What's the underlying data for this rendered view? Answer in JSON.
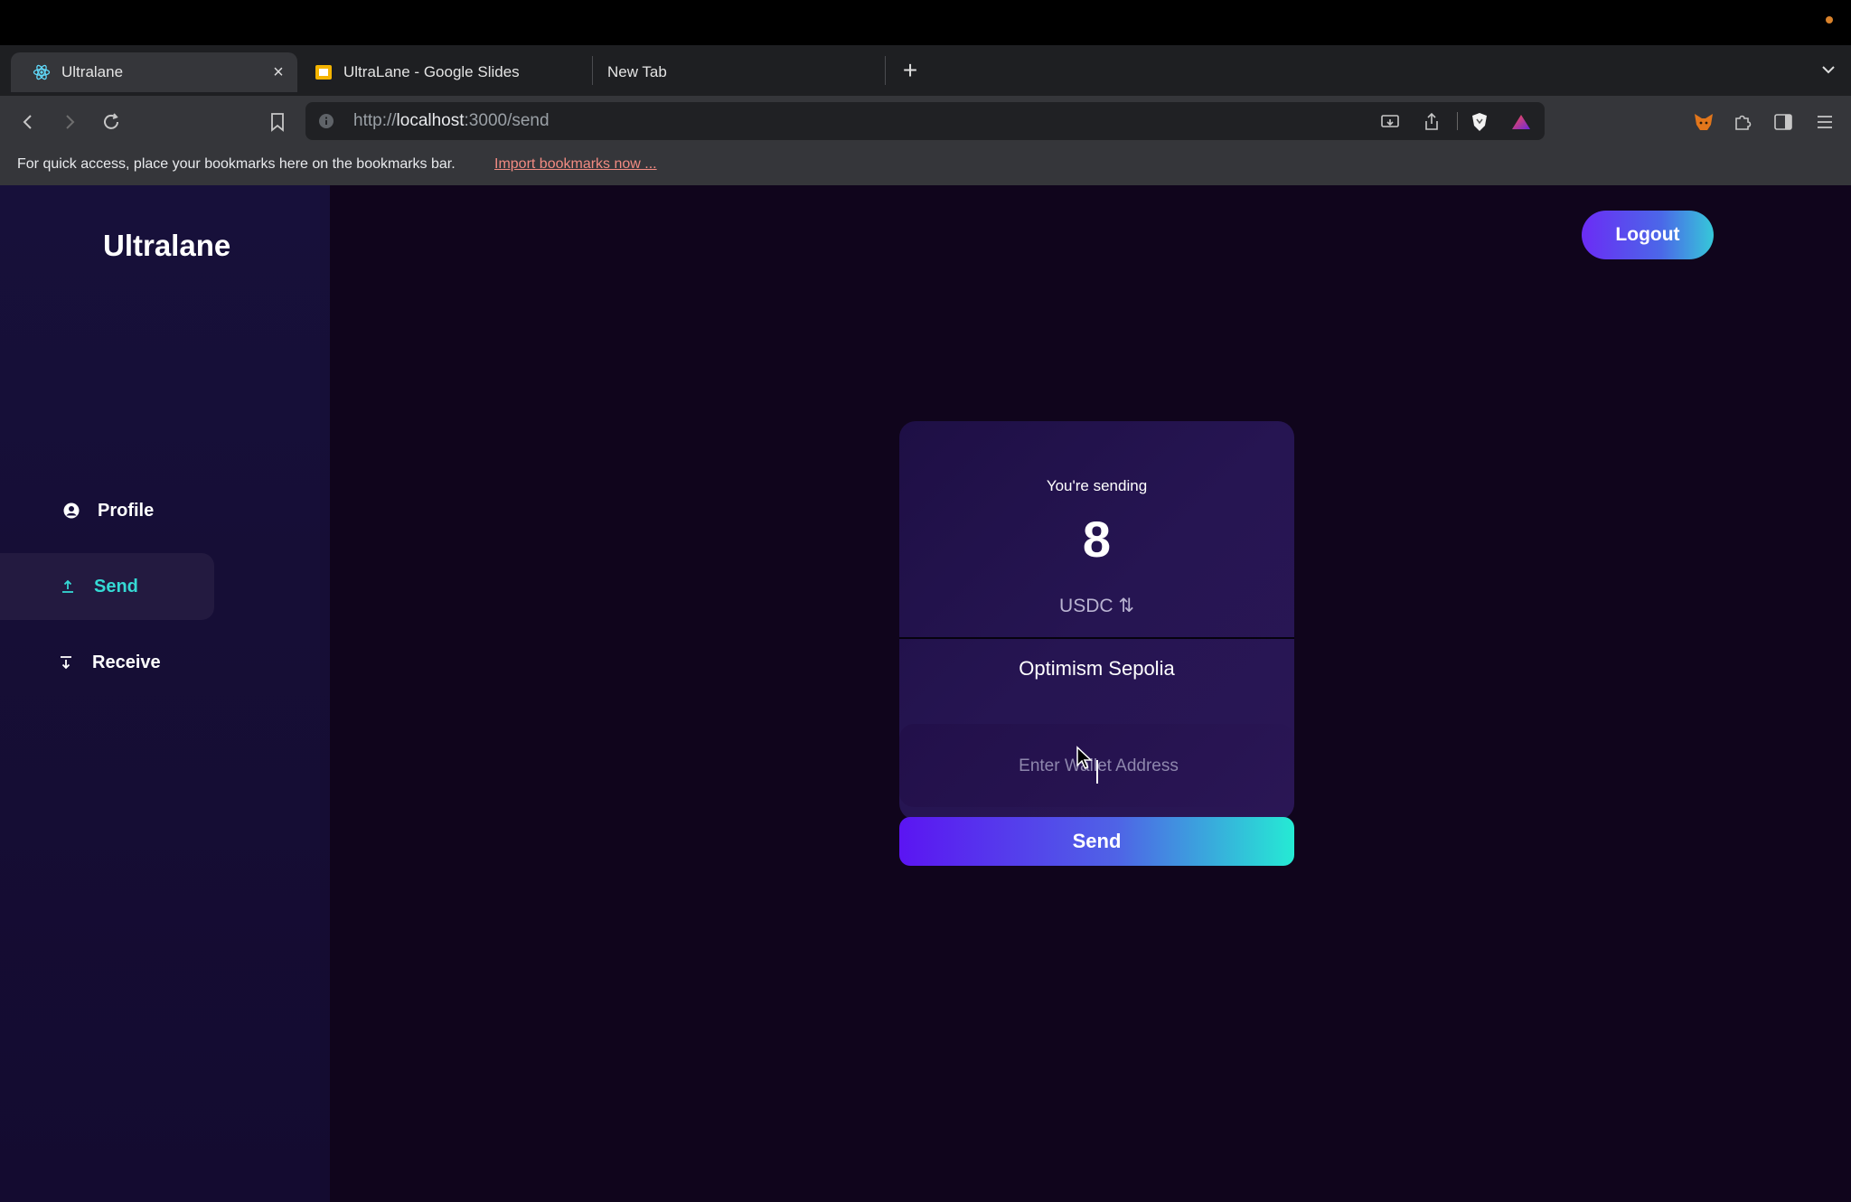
{
  "browser": {
    "tabs": [
      {
        "title": "Ultralane",
        "favicon": "react-icon",
        "active": true
      },
      {
        "title": "UltraLane - Google Slides",
        "favicon": "google-slides-icon",
        "active": false
      },
      {
        "title": "New Tab",
        "favicon": "",
        "active": false
      }
    ],
    "url_scheme": "http://",
    "url_host": "localhost",
    "url_path": ":3000/send",
    "bookmarks_bar": {
      "message": "For quick access, place your bookmarks here on the bookmarks bar.",
      "link": "Import bookmarks now ..."
    }
  },
  "app": {
    "brand": "Ultralane",
    "logout_label": "Logout",
    "sidebar": {
      "items": [
        {
          "label": "Profile",
          "icon": "user-circle-icon",
          "active": false
        },
        {
          "label": "Send",
          "icon": "upload-icon",
          "active": true
        },
        {
          "label": "Receive",
          "icon": "download-icon",
          "active": false
        }
      ]
    },
    "send_card": {
      "label": "You're sending",
      "amount": "8",
      "token": "USDC ⇅",
      "network": "Optimism Sepolia"
    },
    "address_input": {
      "placeholder": "Enter Wallet Address",
      "value": ""
    },
    "send_button_label": "Send"
  },
  "colors": {
    "accent_active": "#35d9d4",
    "gradient_start": "#5b15f2",
    "gradient_end": "#25ead4",
    "background": "#10051c"
  }
}
